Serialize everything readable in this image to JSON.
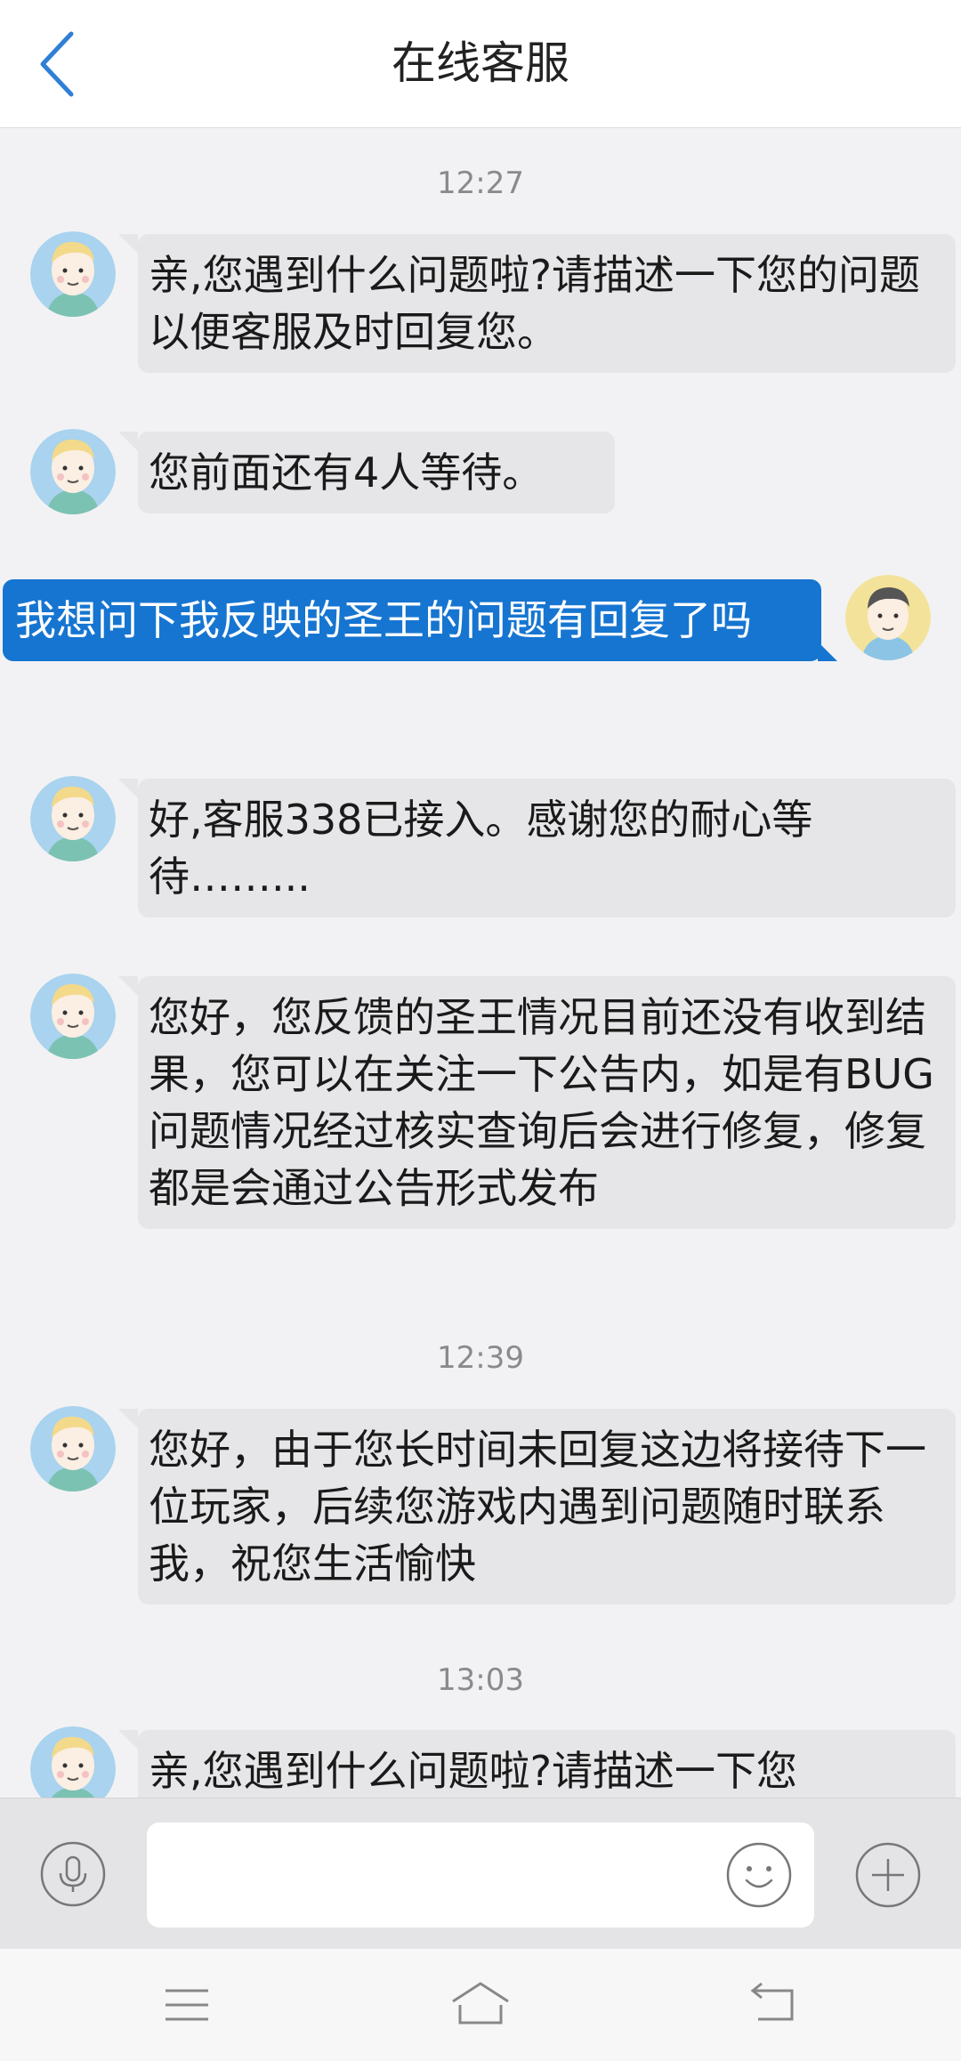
{
  "header": {
    "title": "在线客服",
    "back_icon": "chevron-left-icon",
    "accent": "#2f7fd6"
  },
  "messages": [
    {
      "type": "time",
      "text": "12:27"
    },
    {
      "type": "agent",
      "text": "亲,您遇到什么问题啦?请描述一下您的问题以便客服及时回复您。"
    },
    {
      "type": "agent",
      "text": "您前面还有4人等待。"
    },
    {
      "type": "user",
      "text": "我想问下我反映的圣王的问题有回复了吗"
    },
    {
      "type": "agent",
      "text": "好,客服338已接入。感谢您的耐心等待……..."
    },
    {
      "type": "agent",
      "text": "您好，您反馈的圣王情况目前还没有收到结果，您可以在关注一下公告内，如是有BUG问题情况经过核实查询后会进行修复，修复都是会通过公告形式发布"
    },
    {
      "type": "time",
      "text": "12:39"
    },
    {
      "type": "agent",
      "text": "您好，由于您长时间未回复这边将接待下一位玩家，后续您游戏内遇到问题随时联系我，祝您生活愉快"
    },
    {
      "type": "time",
      "text": "13:03"
    },
    {
      "type": "agent",
      "text": "亲,您遇到什么问题啦?请描述一下您"
    }
  ],
  "input": {
    "value": "",
    "placeholder": ""
  },
  "icons": {
    "mic": "microphone-icon",
    "emoji": "smiley-icon",
    "plus": "plus-icon",
    "nav_menu": "menu-icon",
    "nav_home": "home-icon",
    "nav_back": "back-icon"
  },
  "colors": {
    "user_bubble": "#1675d1",
    "agent_bubble": "#e6e6e8",
    "background": "#f2f2f4"
  }
}
